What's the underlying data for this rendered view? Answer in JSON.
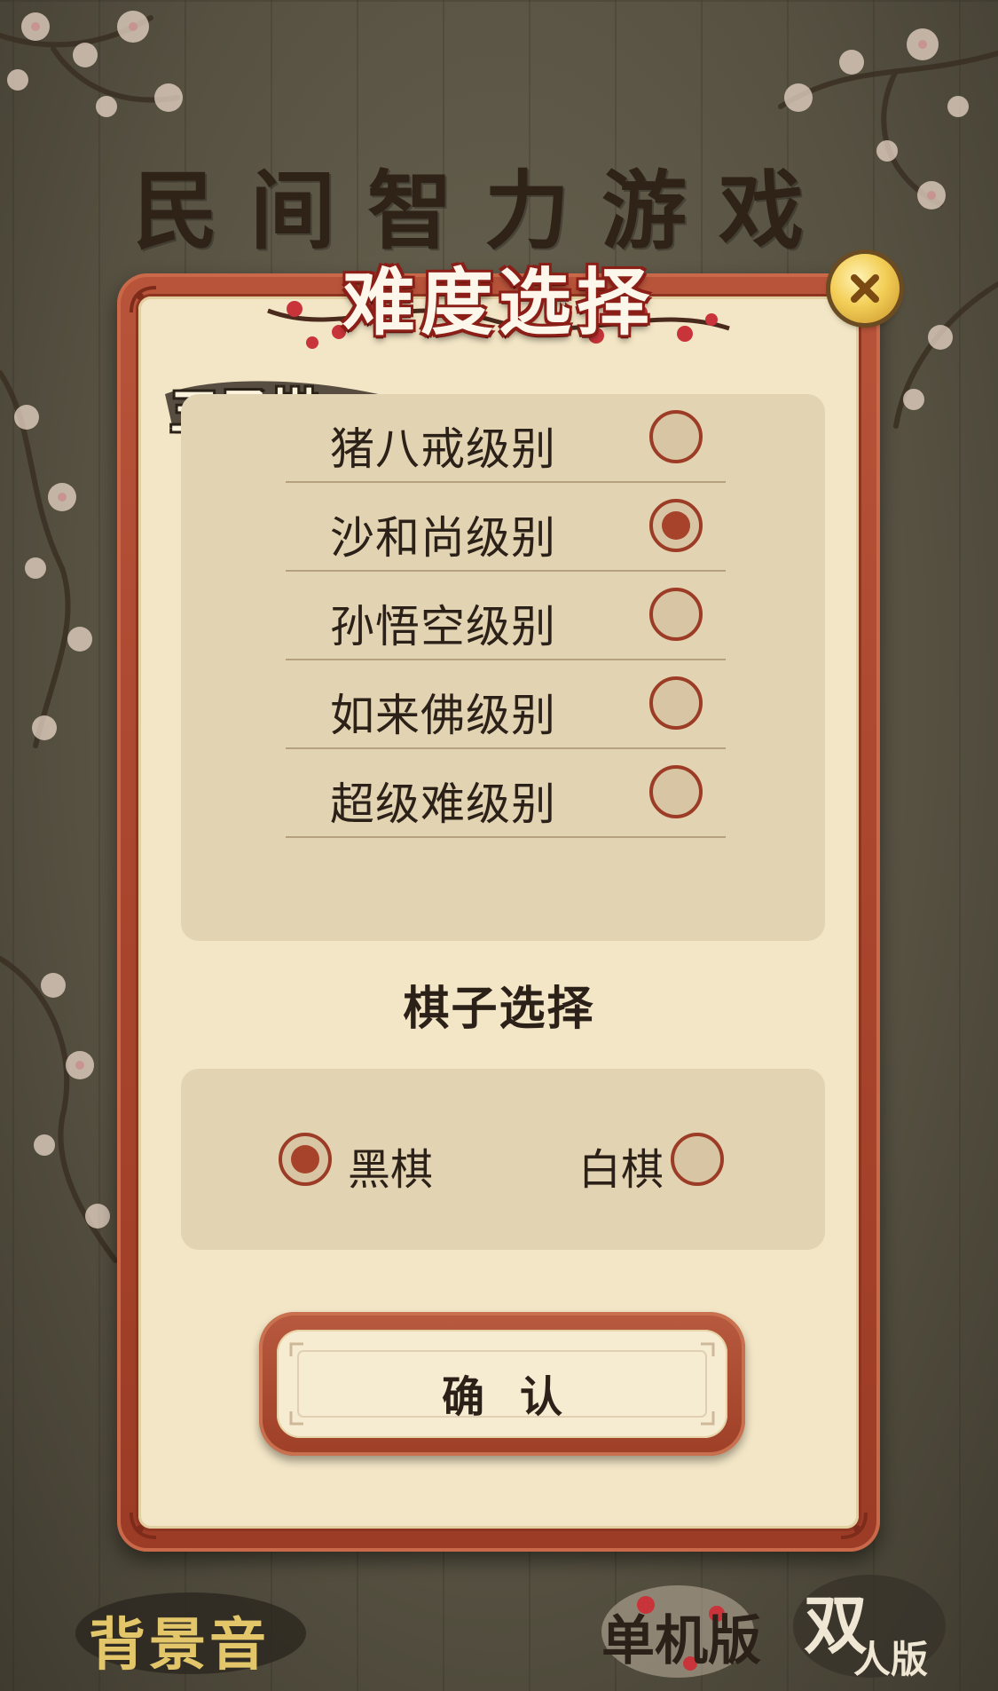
{
  "header": {
    "title": "民间智力游戏"
  },
  "dialog": {
    "title": "难度选择",
    "game_name": "五子棋",
    "difficulty_options": [
      {
        "label": "猪八戒级别",
        "selected": false
      },
      {
        "label": "沙和尚级别",
        "selected": true
      },
      {
        "label": "孙悟空级别",
        "selected": false
      },
      {
        "label": "如来佛级别",
        "selected": false
      },
      {
        "label": "超级难级别",
        "selected": false
      }
    ],
    "piece_heading": "棋子选择",
    "piece_options": [
      {
        "label": "黑棋",
        "selected": true
      },
      {
        "label": "白棋",
        "selected": false
      }
    ],
    "confirm_label": "确认"
  },
  "footer": {
    "music_label": "背景音",
    "single_player_label": "单机版",
    "two_player_main": "双",
    "two_player_sub": "人版"
  },
  "colors": {
    "frame_red": "#a9452d",
    "parchment": "#f3e6c6",
    "panel": "#e2d4b2",
    "radio_fill": "#a7432a",
    "close_gold": "#f3cf57"
  }
}
